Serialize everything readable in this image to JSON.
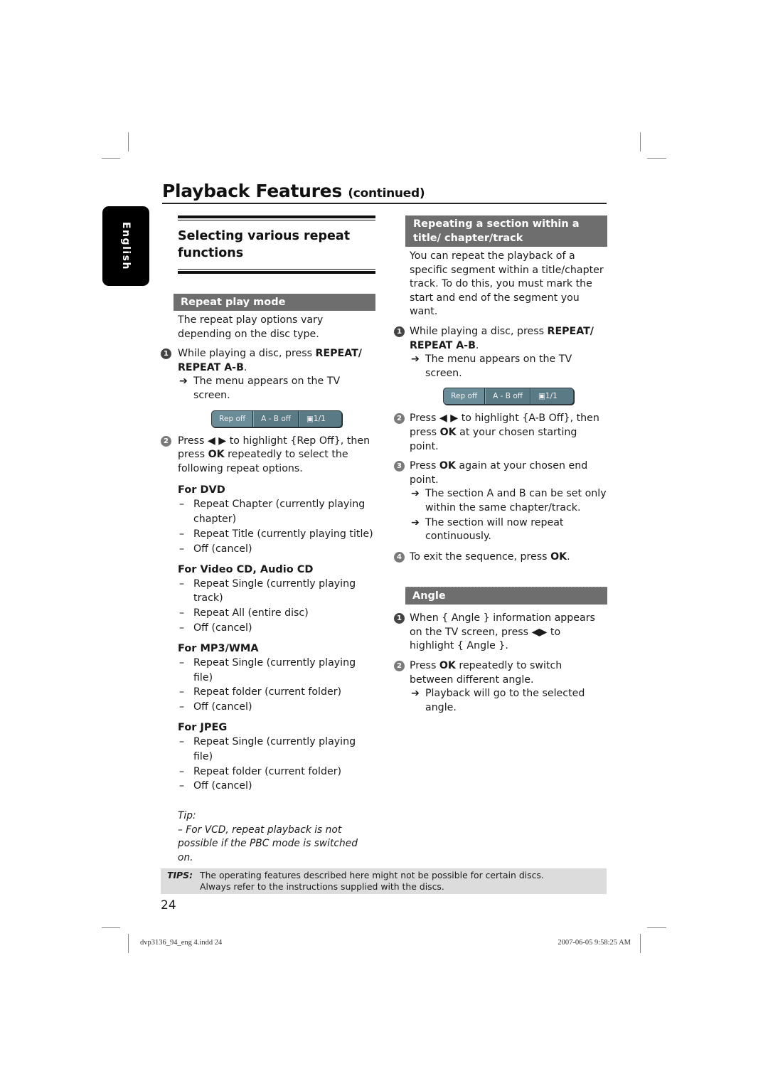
{
  "header": {
    "title": "Playback Features",
    "title_suffix": "(continued)"
  },
  "language_tab": "English",
  "left_column": {
    "section_heading": "Selecting various repeat functions",
    "bar_title": "Repeat play mode",
    "intro": "The repeat play options vary depending on the disc type.",
    "step1": {
      "num": "1",
      "text_a": "While playing a disc, press ",
      "text_bold": "REPEAT/ REPEAT A-B",
      "text_b": ".",
      "result": "The menu appears on the TV screen."
    },
    "osd": {
      "cells": [
        "Rep off",
        "A - B off",
        "1/1"
      ],
      "icon": "camera-angle-icon"
    },
    "step2": {
      "num": "2",
      "text_a": "Press ◀ ▶ to highlight {Rep Off}, then press ",
      "text_bold": "OK",
      "text_b": " repeatedly to select the following repeat options."
    },
    "groups": [
      {
        "heading": "For DVD",
        "items": [
          "Repeat Chapter (currently playing chapter)",
          "Repeat Title (currently playing title)",
          "Off (cancel)"
        ]
      },
      {
        "heading": "For Video CD, Audio CD",
        "items": [
          "Repeat Single (currently playing track)",
          "Repeat All (entire disc)",
          "Off (cancel)"
        ]
      },
      {
        "heading": "For MP3/WMA",
        "items": [
          "Repeat Single (currently playing file)",
          "Repeat folder (current folder)",
          "Off (cancel)"
        ]
      },
      {
        "heading": "For JPEG",
        "items": [
          "Repeat Single (currently playing file)",
          "Repeat folder (current folder)",
          "Off (cancel)"
        ]
      }
    ],
    "tip_label": "Tip:",
    "tip_text": "– For VCD, repeat playback is not possible if the PBC mode is switched on."
  },
  "right_column": {
    "ab_section": {
      "bar_title": "Repeating a section within a title/ chapter/track",
      "intro": "You can repeat the playback of a specific segment within a title/chapter track. To do this, you must mark the start and end of the segment you want.",
      "step1": {
        "num": "1",
        "text_a": "While playing a disc, press ",
        "text_bold": "REPEAT/ REPEAT A-B",
        "text_b": ".",
        "result": "The menu appears on the TV screen."
      },
      "osd": {
        "cells": [
          "Rep off",
          "A - B off",
          "1/1"
        ]
      },
      "step2": {
        "num": "2",
        "text_a": "Press ◀ ▶ to highlight {A-B Off}, then press ",
        "text_bold": "OK",
        "text_b": " at your chosen starting point."
      },
      "step3": {
        "num": "3",
        "text_a": "Press ",
        "text_bold": "OK",
        "text_b": " again at your chosen end point.",
        "result1": "The section A and B can be set only within the same chapter/track.",
        "result2": "The section will now repeat continuously."
      },
      "step4": {
        "num": "4",
        "text_a": "To exit the sequence, press ",
        "text_bold": "OK",
        "text_b": "."
      }
    },
    "angle_section": {
      "bar_title": "Angle",
      "step1": {
        "num": "1",
        "text": "When { Angle } information appears on the TV screen, press ◀▶ to highlight { Angle }."
      },
      "step2": {
        "num": "2",
        "text_a": "Press ",
        "text_bold": "OK",
        "text_b": " repeatedly to switch between different angle.",
        "result": "Playback will go to the selected angle."
      }
    }
  },
  "tips_box": {
    "label": "TIPS:",
    "line1": "The operating features described here might not be possible for certain discs.",
    "line2": "Always refer to the instructions supplied with the discs."
  },
  "page_number": "24",
  "slug": {
    "file": "dvp3136_94_eng 4.indd   24",
    "timestamp": "2007-06-05   9:58:25 AM"
  },
  "symbols": {
    "arrow": "➔",
    "dash": "–"
  }
}
